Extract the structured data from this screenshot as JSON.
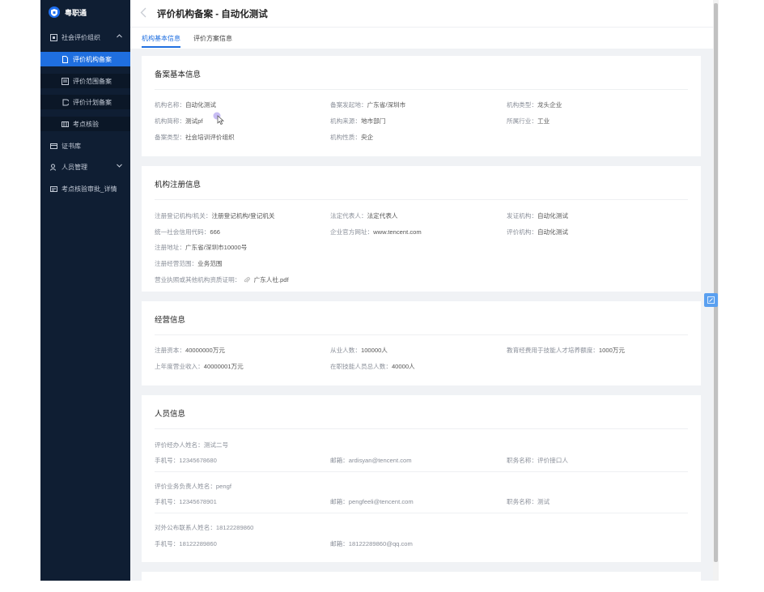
{
  "app": {
    "name": "粤职通"
  },
  "sidebar": {
    "items": [
      {
        "label": "社会评价组织",
        "icon": "org-icon"
      },
      {
        "label": "评价机构备案",
        "icon": "doc-icon"
      },
      {
        "label": "评价范围备案",
        "icon": "scope-icon"
      },
      {
        "label": "评价计划备案",
        "icon": "plan-icon"
      },
      {
        "label": "考点核验",
        "icon": "grid-icon"
      },
      {
        "label": "证书库",
        "icon": "certificate-icon"
      },
      {
        "label": "人员管理",
        "icon": "people-icon"
      },
      {
        "label": "考点核验审批_详情",
        "icon": "list-icon"
      }
    ]
  },
  "page": {
    "title": "评价机构备案 - 自动化测试"
  },
  "tabs": [
    {
      "label": "机构基本信息"
    },
    {
      "label": "评价方案信息"
    }
  ],
  "sections": {
    "basic": {
      "title": "备案基本信息",
      "fields": [
        {
          "label": "机构名称：",
          "value": "自动化测试"
        },
        {
          "label": "备案发起地：",
          "value": "广东省/深圳市"
        },
        {
          "label": "机构类型：",
          "value": "龙头企业"
        },
        {
          "label": "机构简称：",
          "value": "测试pf"
        },
        {
          "label": "机构来源：",
          "value": "地市部门"
        },
        {
          "label": "所属行业：",
          "value": "工业"
        },
        {
          "label": "备案类型：",
          "value": "社会培训评价组织"
        },
        {
          "label": "机构性质：",
          "value": "央企"
        }
      ]
    },
    "registration": {
      "title": "机构注册信息",
      "fields": [
        {
          "label": "注册登记机构/机关：",
          "value": "注册登记机构/登记机关"
        },
        {
          "label": "法定代表人：",
          "value": "法定代表人"
        },
        {
          "label": "发证机构：",
          "value": "自动化测试"
        },
        {
          "label": "统一社会信用代码：",
          "value": "666"
        },
        {
          "label": "企业官方网址：",
          "value": "www.tencent.com"
        },
        {
          "label": "评价机构：",
          "value": "自动化测试"
        },
        {
          "label": "注册地址：",
          "value": "广东省/深圳市10000号"
        },
        {
          "label": "注册经营范围：",
          "value": "业务范围"
        },
        {
          "label": "营业执照或其他机构资质证明：",
          "value": "广东人社.pdf"
        }
      ]
    },
    "operation": {
      "title": "经营信息",
      "fields": [
        {
          "label": "注册资本：",
          "value": "40000000万元"
        },
        {
          "label": "从业人数：",
          "value": "100000人"
        },
        {
          "label": "教育经费用于技能人才培养额度：",
          "value": "1000万元"
        },
        {
          "label": "上年度营业收入：",
          "value": "40000001万元"
        },
        {
          "label": "在职技能人员总人数：",
          "value": "40000人"
        }
      ]
    },
    "personnel": {
      "title": "人员信息",
      "groups": [
        {
          "name": "评价经办人姓名：测试二号",
          "phone": "手机号：12345678680",
          "email": "邮箱：ardisyan@tencent.com",
          "position": "职务名称：评价接口人"
        },
        {
          "name": "评价业务负责人姓名：pengf",
          "phone": "手机号：12345678901",
          "email": "邮箱：pengfeeli@tencent.com",
          "position": "职务名称：测试"
        },
        {
          "name": "对外公布联系人姓名：18122289860",
          "phone": "手机号：18122289860",
          "email": "邮箱：18122289860@qq.com"
        }
      ]
    }
  },
  "colors": {
    "sidebar_bg": "#0f1e33",
    "accent": "#1f6fe0",
    "page_bg": "#f0f2f5"
  }
}
